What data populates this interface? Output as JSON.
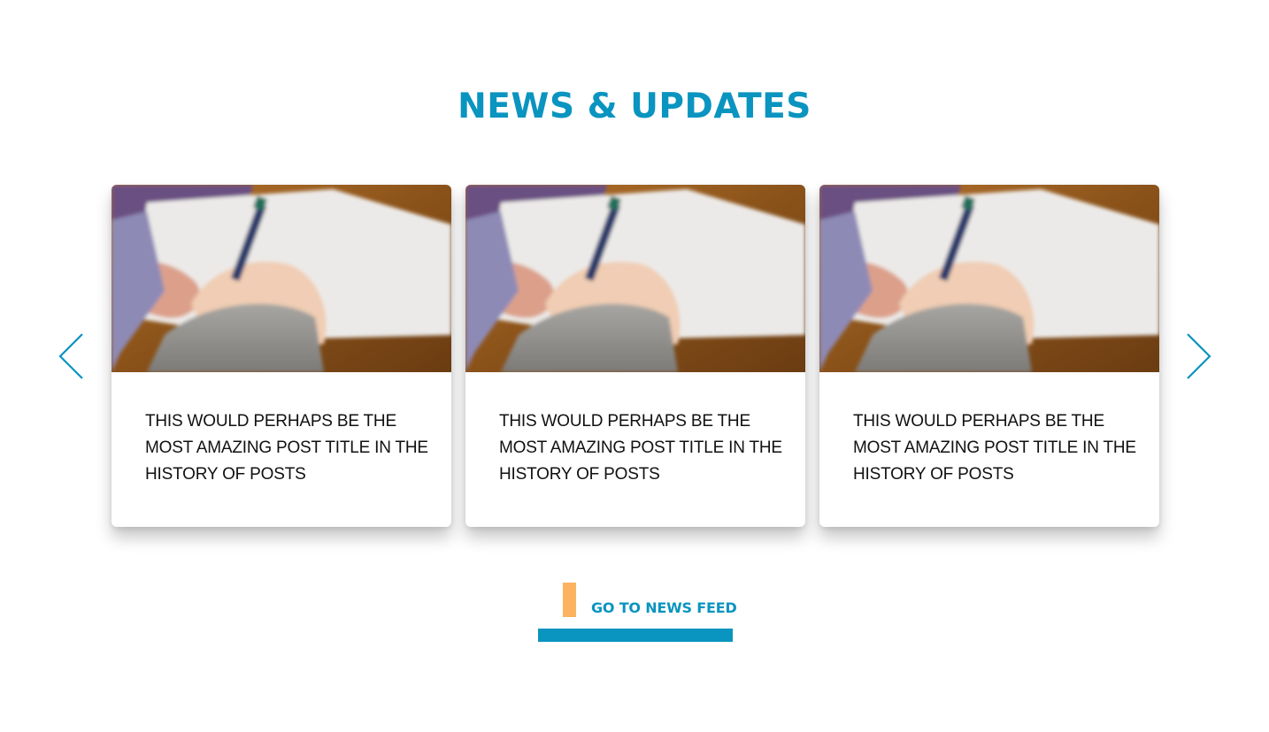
{
  "section": {
    "title": "NEWS & UPDATES"
  },
  "carousel": {
    "prev_icon": "chevron-left-icon",
    "next_icon": "chevron-right-icon",
    "cards": [
      {
        "image": "hand-writing-with-pencil-photo",
        "title": "THIS WOULD PERHAPS BE THE MOST AMAZING POST TITLE IN THE HISTORY OF POSTS"
      },
      {
        "image": "hand-writing-with-pencil-photo",
        "title": "THIS WOULD PERHAPS BE THE MOST AMAZING POST TITLE IN THE HISTORY OF POSTS"
      },
      {
        "image": "hand-writing-with-pencil-photo",
        "title": "THIS WOULD PERHAPS BE THE MOST AMAZING POST TITLE IN THE HISTORY OF POSTS"
      }
    ]
  },
  "cta": {
    "label": "GO TO NEWS FEED"
  },
  "colors": {
    "brand_blue": "#0a94c0",
    "accent_orange": "#fbb360",
    "title_text": "#111111",
    "background": "#ffffff"
  }
}
